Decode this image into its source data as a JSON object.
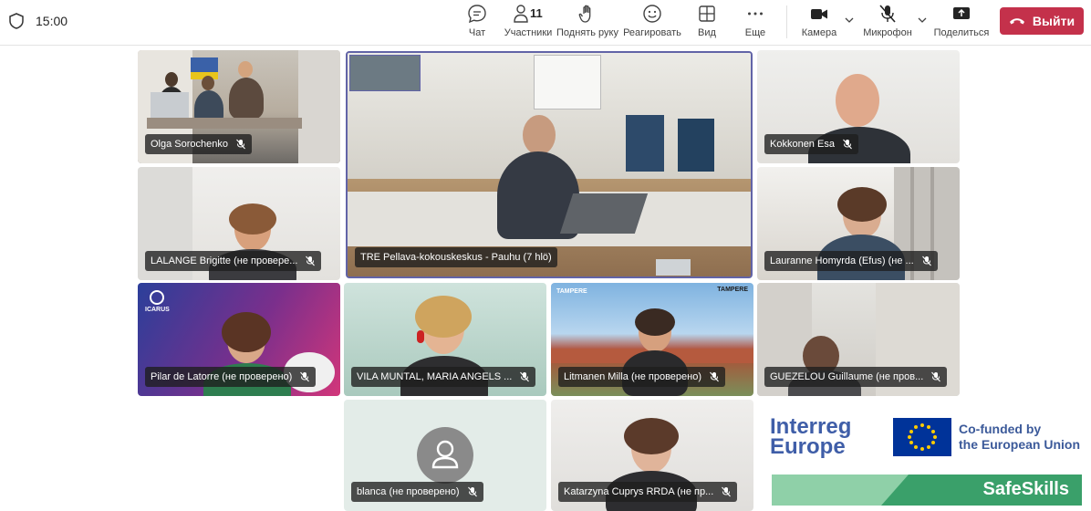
{
  "header": {
    "time": "15:00",
    "participants_count": "11",
    "buttons": {
      "chat": "Чат",
      "participants": "Участники",
      "raise_hand": "Поднять руку",
      "react": "Реагировать",
      "view": "Вид",
      "more": "Еще",
      "camera": "Камера",
      "mic": "Микрофон",
      "share": "Поделиться",
      "leave": "Выйти"
    }
  },
  "participants": [
    {
      "name": "Olga Sorochenko"
    },
    {
      "name": "TRE Pellava-kokouskeskus - Pauhu (7 hlö)"
    },
    {
      "name": "Kokkonen Esa"
    },
    {
      "name": "LALANGE Brigitte (не провере..."
    },
    {
      "name": "Lauranne Homyrda (Efus) (не ..."
    },
    {
      "name": "Pilar de Latorre (не проверено)"
    },
    {
      "name": "VILA MUNTAL, MARIA ANGELS ..."
    },
    {
      "name": "Litmanen Milla (не проверено)"
    },
    {
      "name": "GUEZELOU Guillaume (не пров..."
    },
    {
      "name": "blanca (не проверено)"
    },
    {
      "name": "Katarzyna Cuprys RRDA (не пр..."
    }
  ],
  "logos": {
    "interreg_line1": "Interreg",
    "interreg_line2": "Europe",
    "cofunded_line1": "Co-funded by",
    "cofunded_line2": "the European Union",
    "safeskills": "SafeSkills",
    "icarus": "ICARUS",
    "tampere_left": "TAMPERE",
    "tampere_right": "TAMPERE"
  },
  "colors": {
    "leave": "#c4314b",
    "active_speaker_border": "#6264a7"
  }
}
